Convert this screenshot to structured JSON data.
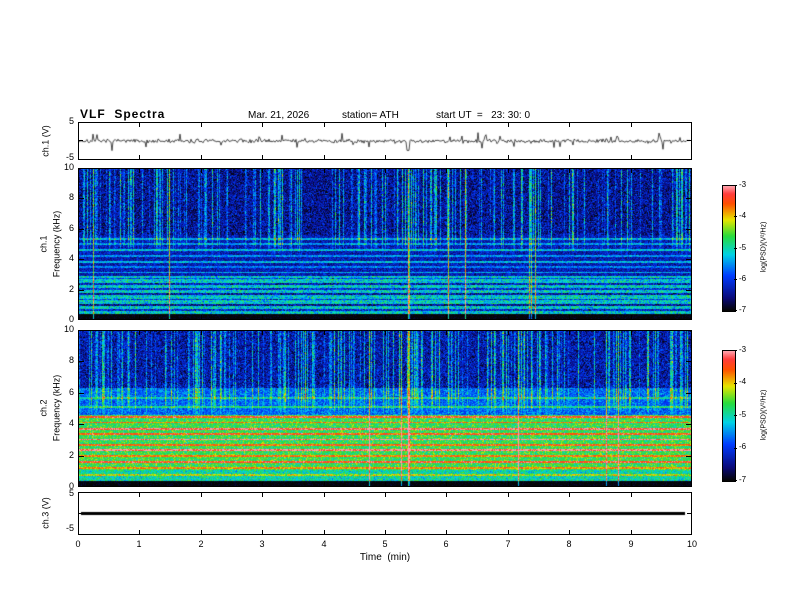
{
  "header": {
    "title": "VLF  Spectra",
    "date": "Mar. 21, 2026",
    "station": "station= ATH",
    "start_ut": "start UT  =   23: 30: 0"
  },
  "x_axis": {
    "label": "Time  (min)",
    "ticks": [
      "0",
      "1",
      "2",
      "3",
      "4",
      "5",
      "6",
      "7",
      "8",
      "9",
      "10"
    ]
  },
  "panels": {
    "ch1_wave": {
      "ylabel": "ch.1 (V)",
      "yticks": [
        "5",
        "-5"
      ]
    },
    "ch1_spec": {
      "ylabel_ch": "ch.1",
      "ylabel_freq": "Frequency  (kHz)",
      "yticks": [
        "10",
        "8",
        "6",
        "4",
        "2",
        "0"
      ]
    },
    "ch2_spec": {
      "ylabel_ch": "ch.2",
      "ylabel_freq": "Frequency  (kHz)",
      "yticks": [
        "10",
        "8",
        "6",
        "4",
        "2",
        "0"
      ]
    },
    "ch3_wave": {
      "ylabel": "ch.3 (V)",
      "yticks": [
        "5",
        "-5"
      ]
    }
  },
  "colorbars": {
    "label": "log(PSD)(V²/Hz)",
    "ticks": [
      "-3",
      "-4",
      "-5",
      "-6",
      "-7"
    ]
  },
  "render": {
    "background": "#ffffff",
    "axis_color": "#000000",
    "colormap": [
      [
        0.0,
        "#050505"
      ],
      [
        0.1,
        "#0a0a78"
      ],
      [
        0.28,
        "#003cff"
      ],
      [
        0.45,
        "#00d2e6"
      ],
      [
        0.6,
        "#28dc3c"
      ],
      [
        0.73,
        "#e6e600"
      ],
      [
        0.86,
        "#ff5000"
      ],
      [
        0.94,
        "#ff3c3c"
      ],
      [
        1.0,
        "#ffa0aa"
      ]
    ]
  },
  "chart_data": [
    {
      "id": "ch1_waveform",
      "type": "line",
      "channel": "ch.1",
      "xlabel": "Time (min)",
      "ylabel": "ch.1 (V)",
      "xlim": [
        0,
        10
      ],
      "ylim": [
        -5,
        5
      ],
      "description": "Dense noisy raw signal fluctuating around 0 V, typical amplitude ±1.5 V with intermittent spikes to about ±2.5 V over the full 10 minutes",
      "noise_v": 0.55,
      "spike_prob": 0.05,
      "spike_v": 2.2,
      "event_t_min": 5.38
    },
    {
      "id": "ch1_spectrogram",
      "type": "heatmap",
      "channel": "ch.1",
      "xlabel": "Time (min)",
      "ylabel": "Frequency (kHz)",
      "zlabel": "log(PSD)(V²/Hz)",
      "xlim_min": [
        0,
        10
      ],
      "ylim_khz": [
        0,
        10
      ],
      "zlim_logpsd": [
        -7,
        -3
      ],
      "description": "VLF spectrogram: black band below 0.35 kHz; cyan background (~-5.2) from 0.35-2.9 kHz crossed by dark horizontal interference lines; dark blue band (~-6.3) 2.9-5.6 kHz with faint cyan horizontal lines; blue background (~-6.5) above 5.6 kHz with dense vertical sferic streaks; strong yellow-orange vertical event near t=5.4 min",
      "bands": [
        {
          "f": [
            0,
            0.35
          ],
          "level": -7.0,
          "noise": 0.15
        },
        {
          "f": [
            0.35,
            2.9
          ],
          "level": -5.15,
          "noise": 0.5
        },
        {
          "f": [
            2.9,
            5.6
          ],
          "level": -6.3,
          "noise": 0.35
        },
        {
          "f": [
            5.6,
            10
          ],
          "level": -6.45,
          "noise": 0.5
        }
      ],
      "h_lines": [
        {
          "f": 0.6,
          "d": -1.0
        },
        {
          "f": 0.95,
          "d": -1.3
        },
        {
          "f": 1.3,
          "d": -0.8
        },
        {
          "f": 1.65,
          "d": -1.2
        },
        {
          "f": 2.0,
          "d": -0.9
        },
        {
          "f": 2.35,
          "d": -1.1
        },
        {
          "f": 2.7,
          "d": -0.8
        },
        {
          "f": 3.1,
          "d": 0.9
        },
        {
          "f": 3.45,
          "d": 0.7
        },
        {
          "f": 3.8,
          "d": 1.0
        },
        {
          "f": 4.2,
          "d": 0.8
        },
        {
          "f": 4.6,
          "d": 1.0
        },
        {
          "f": 5.0,
          "d": 0.8
        },
        {
          "f": 5.35,
          "d": 0.9
        }
      ],
      "streaks": {
        "prob": 0.3,
        "boost_min": 0.4,
        "boost_max": 1.7,
        "f_min_khz": 4.2,
        "strong_prob": 0.015,
        "strong_boost": 2.0
      },
      "events": [
        {
          "t": 5.38,
          "boost": 2.2
        }
      ]
    },
    {
      "id": "ch2_spectrogram",
      "type": "heatmap",
      "channel": "ch.2",
      "xlabel": "Time (min)",
      "ylabel": "Frequency (kHz)",
      "zlabel": "log(PSD)(V²/Hz)",
      "xlim_min": [
        0,
        10
      ],
      "ylim_khz": [
        0,
        10
      ],
      "zlim_logpsd": [
        -7,
        -3
      ],
      "description": "VLF spectrogram: black band below 0.35 kHz; bright green background (~-4.7) from 0.35-4.6 kHz crossed by many yellow/orange/red horizontal interference lines; transition band 4.6-6.3 kHz; blue background (~-6.4) above 6.3 kHz with dense vertical sferic streaks; strong orange vertical event near t=5.4 min",
      "bands": [
        {
          "f": [
            0,
            0.35
          ],
          "level": -7.0,
          "noise": 0.15
        },
        {
          "f": [
            0.35,
            1.0
          ],
          "level": -5.0,
          "noise": 0.45
        },
        {
          "f": [
            1.0,
            4.6
          ],
          "level": -4.65,
          "noise": 0.4
        },
        {
          "f": [
            4.6,
            6.3
          ],
          "level": -5.7,
          "noise": 0.4
        },
        {
          "f": [
            6.3,
            10
          ],
          "level": -6.35,
          "noise": 0.5
        }
      ],
      "h_lines": [
        {
          "f": 0.7,
          "d": 0.8
        },
        {
          "f": 1.15,
          "d": 0.9
        },
        {
          "f": 1.55,
          "d": 1.3
        },
        {
          "f": 1.95,
          "d": 1.0
        },
        {
          "f": 2.3,
          "d": 1.6
        },
        {
          "f": 2.65,
          "d": 1.1
        },
        {
          "f": 3.0,
          "d": 1.7
        },
        {
          "f": 3.35,
          "d": 1.2
        },
        {
          "f": 3.7,
          "d": 1.5
        },
        {
          "f": 4.1,
          "d": 1.0
        },
        {
          "f": 4.45,
          "d": 1.3
        },
        {
          "f": 5.1,
          "d": 0.8
        },
        {
          "f": 5.7,
          "d": 0.7
        }
      ],
      "streaks": {
        "prob": 0.3,
        "boost_min": 0.4,
        "boost_max": 1.7,
        "f_min_khz": 4.5,
        "strong_prob": 0.015,
        "strong_boost": 2.0
      },
      "events": [
        {
          "t": 5.38,
          "boost": 2.4
        }
      ]
    },
    {
      "id": "ch3_waveform",
      "type": "line",
      "channel": "ch.3",
      "xlabel": "Time (min)",
      "ylabel": "ch.3 (V)",
      "xlim": [
        0,
        10
      ],
      "ylim": [
        -5,
        5
      ],
      "value": 0,
      "thickness_px": 3,
      "description": "Completely flat thick trace at 0 V for the whole record (channel inactive)"
    }
  ]
}
